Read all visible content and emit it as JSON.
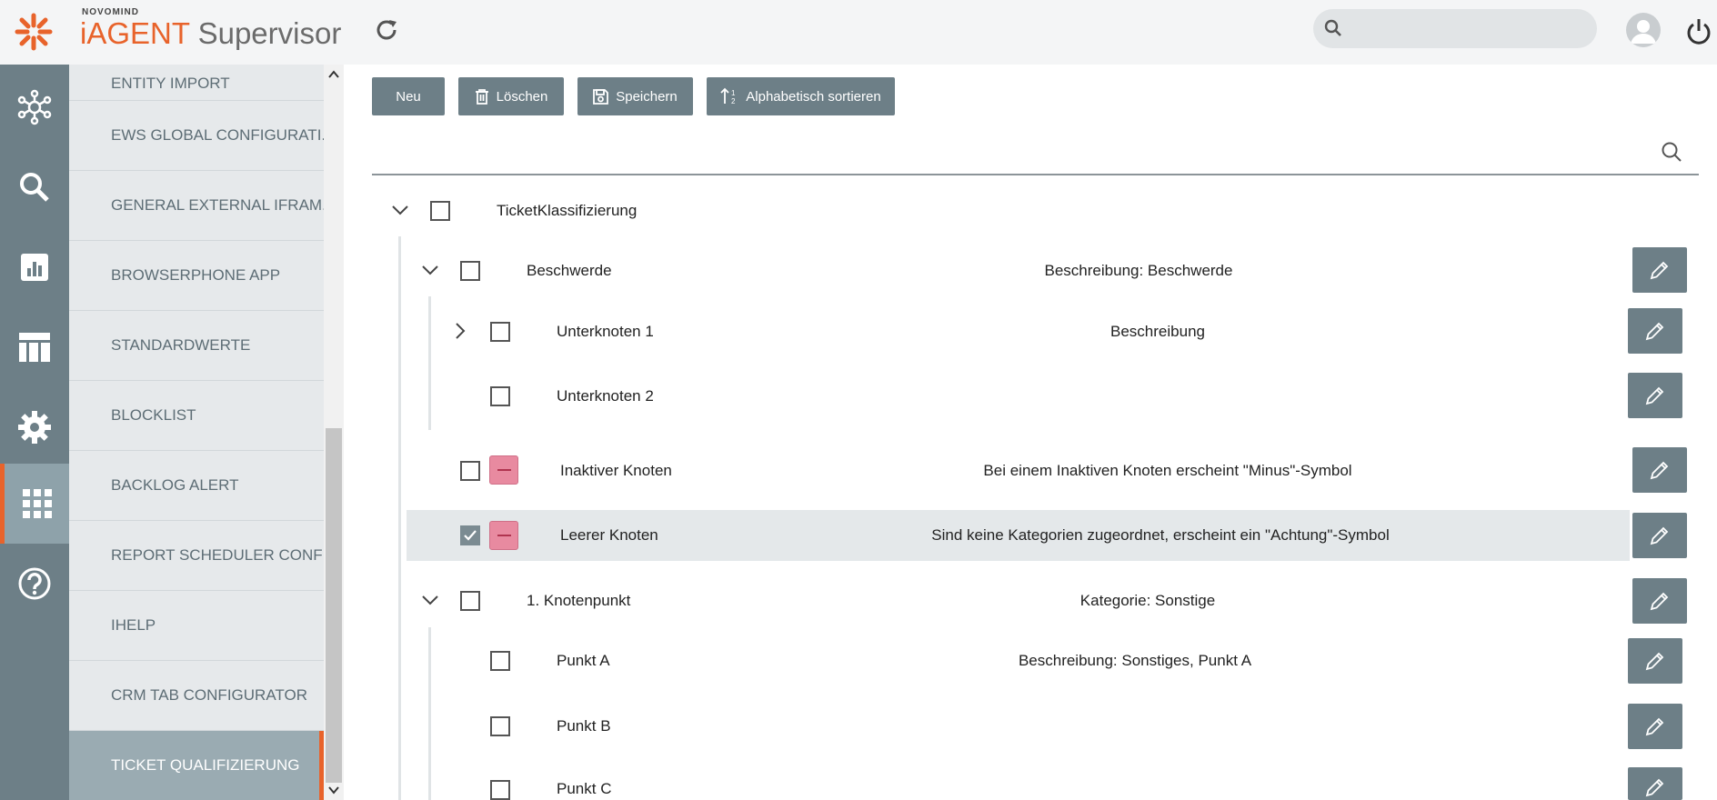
{
  "header": {
    "brand_small": "NOVOMIND",
    "brand_name": "iAGENT",
    "brand_product": "Supervisor",
    "search_placeholder": ""
  },
  "menu": {
    "items": [
      {
        "label": "ENTITY IMPORT"
      },
      {
        "label": "EWS GLOBAL CONFIGURATI..."
      },
      {
        "label": "GENERAL EXTERNAL IFRAM..."
      },
      {
        "label": "BROWSERPHONE APP"
      },
      {
        "label": "STANDARDWERTE"
      },
      {
        "label": "BLOCKLIST"
      },
      {
        "label": "BACKLOG ALERT"
      },
      {
        "label": "REPORT SCHEDULER CONFI..."
      },
      {
        "label": "IHELP"
      },
      {
        "label": "CRM TAB CONFIGURATOR"
      },
      {
        "label": "TICKET QUALIFIZIERUNG"
      }
    ]
  },
  "toolbar": {
    "new_label": "Neu",
    "delete_label": "Löschen",
    "save_label": "Speichern",
    "sort_label": "Alphabetisch sortieren"
  },
  "tree": {
    "root_label": "TicketKlassifizierung",
    "nodes": [
      {
        "label": "Beschwerde",
        "description": "Beschreibung: Beschwerde"
      },
      {
        "label": "Unterknoten 1",
        "description": "Beschreibung"
      },
      {
        "label": "Unterknoten 2",
        "description": ""
      },
      {
        "label": "Inaktiver Knoten",
        "description": "Bei einem Inaktiven Knoten erscheint \"Minus\"-Symbol"
      },
      {
        "label": "Leerer Knoten",
        "description": "Sind keine Kategorien zugeordnet, erscheint ein \"Achtung\"-Symbol"
      },
      {
        "label": "1. Knotenpunkt",
        "description": "Kategorie: Sonstige"
      },
      {
        "label": "Punkt A",
        "description": "Beschreibung: Sonstiges, Punkt A"
      },
      {
        "label": "Punkt B",
        "description": ""
      },
      {
        "label": "Punkt C",
        "description": ""
      }
    ]
  },
  "colors": {
    "accent": "#e8632b",
    "rail": "#6d7f87",
    "button": "#6d7f87",
    "inactive_badge": "#e88aa0"
  }
}
